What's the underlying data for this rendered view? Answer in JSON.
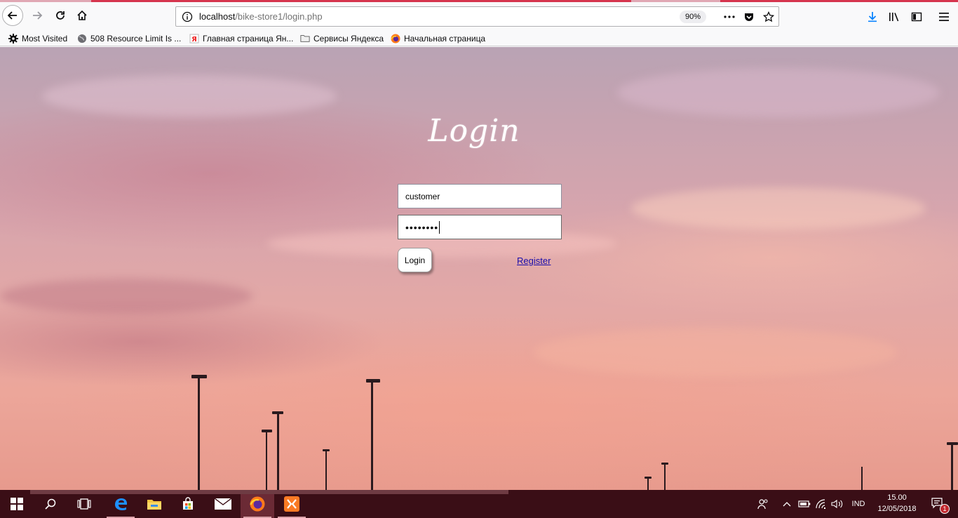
{
  "browser": {
    "url_host": "localhost",
    "url_path": "/bike-store1/login.php",
    "zoom": "90%",
    "bookmarks": [
      {
        "label": "Most Visited",
        "icon": "gear-icon"
      },
      {
        "label": "508 Resource Limit Is ...",
        "icon": "globe-icon"
      },
      {
        "label": "Главная страница Ян...",
        "icon": "yandex-icon"
      },
      {
        "label": "Сервисы Яндекса",
        "icon": "folder-icon"
      },
      {
        "label": "Начальная страница",
        "icon": "firefox-icon"
      }
    ]
  },
  "page": {
    "title": "Login",
    "username_value": "customer",
    "password_mask": "••••••••",
    "login_button": "Login",
    "register_link": "Register"
  },
  "taskbar": {
    "language": "IND",
    "time": "15.00",
    "date": "12/05/2018",
    "notification_count": "1"
  },
  "colors": {
    "tab_accent": "#d6354e",
    "taskbar_bg": "#3a0e16",
    "link": "#1a0dab"
  }
}
